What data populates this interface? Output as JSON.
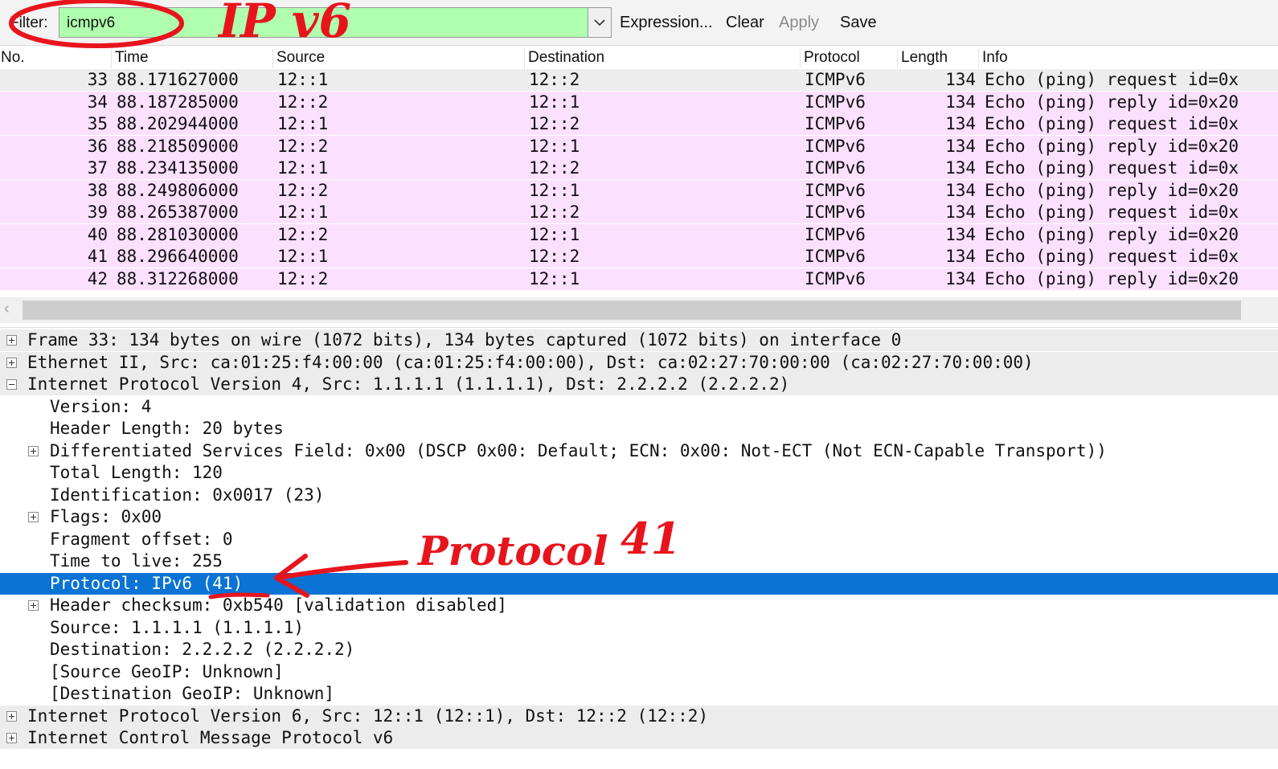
{
  "filter": {
    "label": "Filter:",
    "value": "icmpv6",
    "buttons": {
      "expression": "Expression...",
      "clear": "Clear",
      "apply": "Apply",
      "save": "Save"
    }
  },
  "packet_list": {
    "columns": [
      "No.",
      "Time",
      "Source",
      "Destination",
      "Protocol",
      "Length",
      "Info"
    ],
    "rows": [
      {
        "no": "33",
        "time": "88.171627000",
        "src": "12::1",
        "dst": "12::2",
        "proto": "ICMPv6",
        "len": "134",
        "info": "Echo (ping) request id=0x"
      },
      {
        "no": "34",
        "time": "88.187285000",
        "src": "12::2",
        "dst": "12::1",
        "proto": "ICMPv6",
        "len": "134",
        "info": "Echo (ping) reply id=0x20"
      },
      {
        "no": "35",
        "time": "88.202944000",
        "src": "12::1",
        "dst": "12::2",
        "proto": "ICMPv6",
        "len": "134",
        "info": "Echo (ping) request id=0x"
      },
      {
        "no": "36",
        "time": "88.218509000",
        "src": "12::2",
        "dst": "12::1",
        "proto": "ICMPv6",
        "len": "134",
        "info": "Echo (ping) reply id=0x20"
      },
      {
        "no": "37",
        "time": "88.234135000",
        "src": "12::1",
        "dst": "12::2",
        "proto": "ICMPv6",
        "len": "134",
        "info": "Echo (ping) request id=0x"
      },
      {
        "no": "38",
        "time": "88.249806000",
        "src": "12::2",
        "dst": "12::1",
        "proto": "ICMPv6",
        "len": "134",
        "info": "Echo (ping) reply id=0x20"
      },
      {
        "no": "39",
        "time": "88.265387000",
        "src": "12::1",
        "dst": "12::2",
        "proto": "ICMPv6",
        "len": "134",
        "info": "Echo (ping) request id=0x"
      },
      {
        "no": "40",
        "time": "88.281030000",
        "src": "12::2",
        "dst": "12::1",
        "proto": "ICMPv6",
        "len": "134",
        "info": "Echo (ping) reply id=0x20"
      },
      {
        "no": "41",
        "time": "88.296640000",
        "src": "12::1",
        "dst": "12::2",
        "proto": "ICMPv6",
        "len": "134",
        "info": "Echo (ping) request id=0x"
      },
      {
        "no": "42",
        "time": "88.312268000",
        "src": "12::2",
        "dst": "12::1",
        "proto": "ICMPv6",
        "len": "134",
        "info": "Echo (ping) reply id=0x20"
      }
    ]
  },
  "details": [
    {
      "text": "Frame 33: 134 bytes on wire (1072 bits), 134 bytes captured (1072 bits) on interface 0",
      "level": 0,
      "toggle": "plus",
      "shaded": true
    },
    {
      "text": "Ethernet II, Src: ca:01:25:f4:00:00 (ca:01:25:f4:00:00), Dst: ca:02:27:70:00:00 (ca:02:27:70:00:00)",
      "level": 0,
      "toggle": "plus",
      "shaded": true
    },
    {
      "text": "Internet Protocol Version 4, Src: 1.1.1.1 (1.1.1.1), Dst: 2.2.2.2 (2.2.2.2)",
      "level": 0,
      "toggle": "minus",
      "shaded": true
    },
    {
      "text": "Version: 4",
      "level": 1,
      "toggle": "none"
    },
    {
      "text": "Header Length: 20 bytes",
      "level": 1,
      "toggle": "none"
    },
    {
      "text": "Differentiated Services Field: 0x00 (DSCP 0x00: Default; ECN: 0x00: Not-ECT (Not ECN-Capable Transport))",
      "level": 1,
      "toggle": "plus"
    },
    {
      "text": "Total Length: 120",
      "level": 1,
      "toggle": "none"
    },
    {
      "text": "Identification: 0x0017 (23)",
      "level": 1,
      "toggle": "none"
    },
    {
      "text": "Flags: 0x00",
      "level": 1,
      "toggle": "plus"
    },
    {
      "text": "Fragment offset: 0",
      "level": 1,
      "toggle": "none"
    },
    {
      "text": "Time to live: 255",
      "level": 1,
      "toggle": "none"
    },
    {
      "text": "Protocol: IPv6 (41)",
      "level": 1,
      "toggle": "none",
      "selected": true
    },
    {
      "text": "Header checksum: 0xb540 [validation disabled]",
      "level": 1,
      "toggle": "plus"
    },
    {
      "text": "Source: 1.1.1.1 (1.1.1.1)",
      "level": 1,
      "toggle": "none"
    },
    {
      "text": "Destination: 2.2.2.2 (2.2.2.2)",
      "level": 1,
      "toggle": "none"
    },
    {
      "text": "[Source GeoIP: Unknown]",
      "level": 1,
      "toggle": "none"
    },
    {
      "text": "[Destination GeoIP: Unknown]",
      "level": 1,
      "toggle": "none"
    },
    {
      "text": "Internet Protocol Version 6, Src: 12::1 (12::1), Dst: 12::2 (12::2)",
      "level": 0,
      "toggle": "plus",
      "shaded": true
    },
    {
      "text": "Internet Control Message Protocol v6",
      "level": 0,
      "toggle": "plus",
      "shaded": true
    }
  ],
  "annotations": {
    "ipv6_note": "IP v6",
    "protocol_note": "Protocol",
    "protocol_number_note": "41",
    "color": "#e8141c"
  },
  "colors": {
    "filter_bg": "#afffaf",
    "row_icmpv6": "#fce0ff",
    "row_selected_list": "#ededed",
    "tree_selected": "#0a73d4"
  }
}
